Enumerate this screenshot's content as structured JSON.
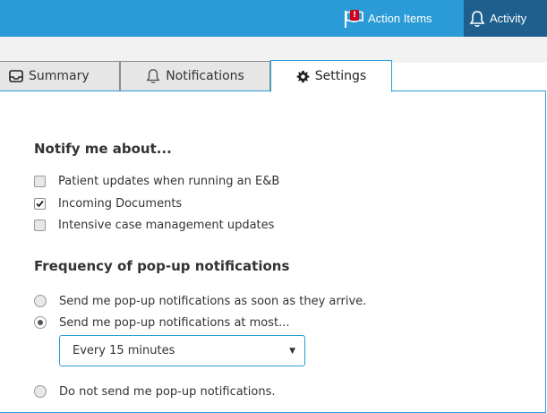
{
  "header": {
    "action_items_label": "Action Items",
    "action_items_badge": "!",
    "activity_label": "Activity",
    "colors": {
      "bar": "#2a9bd6",
      "activity_bg": "#1f5f8d",
      "badge": "#d0021b"
    }
  },
  "tabs": [
    {
      "label": "Summary",
      "icon": "inbox-icon",
      "active": false
    },
    {
      "label": "Notifications",
      "icon": "bell-icon",
      "active": false
    },
    {
      "label": "Settings",
      "icon": "gear-icon",
      "active": true
    }
  ],
  "settings": {
    "notify_title": "Notify me about...",
    "notify_options": [
      {
        "label": "Patient updates when running an E&B",
        "checked": false
      },
      {
        "label": "Incoming Documents",
        "checked": true
      },
      {
        "label": "Intensive case management updates",
        "checked": false
      }
    ],
    "frequency_title": "Frequency of pop-up notifications",
    "frequency_options": [
      {
        "label": "Send me pop-up notifications as soon as they arrive.",
        "selected": false
      },
      {
        "label": "Send me pop-up notifications at most...",
        "selected": true
      },
      {
        "label": "Do not send me pop-up notifications.",
        "selected": false
      }
    ],
    "interval_select": {
      "value": "Every 15 minutes"
    }
  }
}
